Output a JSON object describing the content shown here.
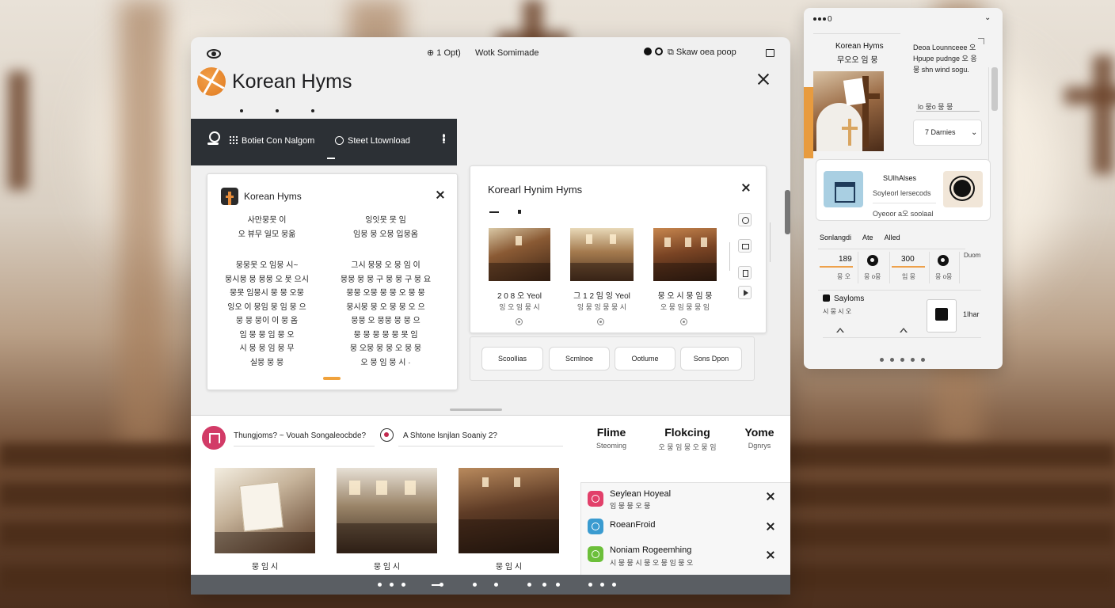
{
  "titlebar": {
    "center_left": "1 Opt)",
    "center_right": "Wotk Somimade",
    "right_text": "Skaw oea poop"
  },
  "app": {
    "title": "Korean Hyms"
  },
  "nav": {
    "item1": "Botiet Con Nalgom",
    "item2": "Steet Ltownload"
  },
  "lyrics_card": {
    "title": "Korean Hyms",
    "col1_top": [
      "사만뭉못 이",
      "오 뷰무 일모 뭉옮"
    ],
    "col2_top": [
      "잉잇못 못 임",
      "임뭉 뭉 오뭉 입뭉옴"
    ],
    "col1_body": [
      "뭉뭉못 오 임뭉 시~",
      "뭉시뭉 뭉 뭉뭉 오 못 으시",
      "뭉못 임뭉시 뭉 뭉 오뭉",
      "잉오 이 뭉임 뭉 임 뭉 으",
      "뭉 뭉 뭉이 이 뭉 옴",
      "임 뭉 뭉 임 뭉 오",
      "시 뭉 뭉 임 뭉 무",
      "실뭉 뭉 뭉"
    ],
    "col2_body": [
      "그시 뭉뭉 오 뭉 임 이",
      "뭉뭉 뭉 뭉 구 뭉 뭉 구 뭉 요",
      "뭉뭉 오뭉 뭉 뭉 오 뭉 뭉",
      "뭉시뭉 뭉 오 뭉 뭉 오 으",
      "뭉뭉 오 뭉뭉 뭉 뭉 으",
      "뭉 뭉 뭉 뭉 뭉 못 임",
      "뭉 오뭉 뭉 뭉 오 뭉 뭉",
      "오 뭉 임 뭉 시 ·"
    ]
  },
  "hymn_card": {
    "title": "Korearl Hynim Hyms",
    "thumbs": [
      {
        "label": "2 0 8  오 Yeol",
        "sub": "잉 오 임 뭉 시"
      },
      {
        "label": "그 1 2  임 잉  Yeol",
        "sub": "잉 뭉 잉 뭉 뭉 시"
      },
      {
        "label": "뭉 오  시 뭉 임 뭉",
        "sub": "오 뭉 임 뭉 뭉 임"
      }
    ]
  },
  "buttons": [
    "Scoollias",
    "Scmlnoe",
    "Ootlume",
    "Sons Dpon"
  ],
  "bottom": {
    "question1": "Thungjoms? ~ Vouah Songaleocbde?",
    "question2": "A Shtone lsnjlan Soaniy 2?",
    "stats": [
      {
        "title": "Flime",
        "sub": "Steoming"
      },
      {
        "title": "Flokcing",
        "sub": "오 뭉 임 뭉 오 뭉 임"
      },
      {
        "title": "Yome",
        "sub": "Dgnrys"
      }
    ],
    "thumb_names": [
      "뭉 임 시",
      "뭉 임 시",
      "뭉 임 시"
    ]
  },
  "notifications": [
    {
      "title": "Seylean Hoyeal",
      "sub": "임 뭉 뭉 오 뭉",
      "color": "#e2406a"
    },
    {
      "title": "RoeanFroid",
      "sub": "",
      "color": "#3a9bd0"
    },
    {
      "title": "Noniam Rogeemhing",
      "sub": "시 뭉 뭉 시 뭉 오 뭉 임 뭉 오",
      "color": "#6cbf3a"
    }
  ],
  "right_panel": {
    "top_label": "0",
    "name": "Korean Hyms",
    "name2": "무오오 임 뭉",
    "desc": "Deoa Lounnceee 오 Hpupe pudnge 오 응 뭉 shn wind sogu.",
    "input": "lo 뭉o 뭉 뭉",
    "select": "7 Darnies",
    "card": {
      "title": "SUIhAlses",
      "line1": "Soyleorl lersecods",
      "line2": "Oyeoor a오 soolaal"
    },
    "stat_headers": [
      "Sonlangdi",
      "Ate",
      "Alled"
    ],
    "stats": [
      {
        "value": "189",
        "sub": "뭉 오"
      },
      {
        "value": "",
        "sub": "뭉 o뭉"
      },
      {
        "value": "300",
        "sub": "임 뭉"
      },
      {
        "value": "",
        "sub": "뭉 o뭉"
      }
    ],
    "side_label": "Duom",
    "section_title": "Sayloms",
    "section_sub": "시 뭉 시 오",
    "box_label": "1Ihar"
  },
  "colors": {
    "accent": "#e89b3e",
    "dark_nav": "#2c3035",
    "footer": "#5a5e63"
  }
}
